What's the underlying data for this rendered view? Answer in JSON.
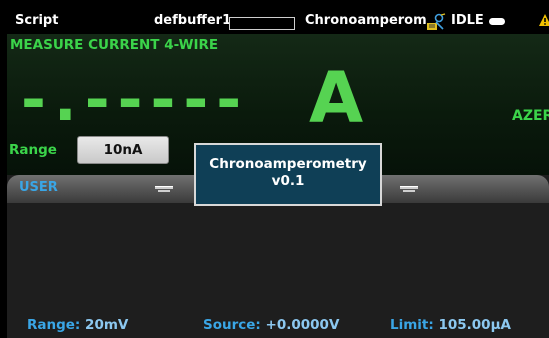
{
  "status_bar": {
    "mode": "Script",
    "buffer": "defbuffer1",
    "title": "Chronoamperom",
    "state": "IDLE",
    "icons": [
      "running-script-icon",
      "idle-indicator-icon",
      "warning-icon"
    ]
  },
  "measure": {
    "function": "MEASURE CURRENT 4-WIRE",
    "readout": "-.-----",
    "units": "A",
    "autozero": "AZER",
    "range_label": "Range",
    "range_value": "10nA"
  },
  "swipe": {
    "tab_label": "USER",
    "source_range_label": "Range:",
    "source_range_value": "20mV",
    "source_label": "Source:",
    "source_value": "+0.0000V",
    "limit_label": "Limit:",
    "limit_value": "105.00µA"
  },
  "dialog": {
    "line1": "Chronoamperometry",
    "line2": "v0.1"
  },
  "colors": {
    "measure_green": "#56d352",
    "accent_blue": "#3aa6e6",
    "dialog_bg": "#0f3f56"
  }
}
